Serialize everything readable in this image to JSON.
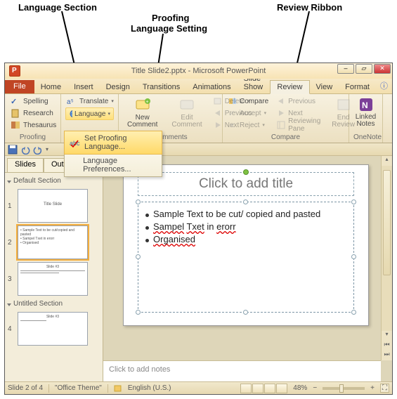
{
  "annotations": {
    "language_section": "Language Section",
    "review_ribbon": "Review Ribbon",
    "proofing_lang_line1": "Proofing",
    "proofing_lang_line2": "Language Setting"
  },
  "titlebar": {
    "title": "Title Slide2.pptx - Microsoft PowerPoint"
  },
  "tabs": {
    "file": "File",
    "home": "Home",
    "insert": "Insert",
    "design": "Design",
    "transitions": "Transitions",
    "animations": "Animations",
    "slideshow": "Slide Show",
    "review": "Review",
    "view": "View",
    "format": "Format"
  },
  "ribbon": {
    "proofing": {
      "label": "Proofing",
      "spelling": "Spelling",
      "research": "Research",
      "thesaurus": "Thesaurus"
    },
    "language": {
      "translate": "Translate",
      "language": "Language",
      "menu_set": "Set Proofing Language...",
      "menu_prefs": "Language Preferences..."
    },
    "comments": {
      "label": "Comments",
      "new": "New\nComment",
      "edit": "Edit\nComment",
      "delete": "Delete",
      "previous": "Previous",
      "next": "Next"
    },
    "compare": {
      "label": "Compare",
      "compare": "Compare",
      "accept": "Accept",
      "reject": "Reject",
      "previous": "Previous",
      "next": "Next",
      "reviewing_pane": "Reviewing Pane",
      "end": "End\nReview"
    },
    "onenote": {
      "label": "OneNote",
      "linked": "Linked\nNotes"
    }
  },
  "sidepanel": {
    "tab_slides": "Slides",
    "tab_outline": "Outline",
    "section_default": "Default Section",
    "section_untitled": "Untitled Section",
    "thumb1": "Title Slide",
    "thumb2_l1": "Sample Text to be cut/copied and pasted",
    "thumb2_l2": "Sampel Txet in erorr",
    "thumb2_l3": "Organised",
    "thumb3_title": "Slide #3",
    "thumb4_title": "Slide #3"
  },
  "slide": {
    "title_placeholder": "Click to add title",
    "bul1": "Sample Text to be cut/ copied and pasted",
    "bul2_a": "Sampel",
    "bul2_b": "Txet",
    "bul2_c": " in ",
    "bul2_d": "erorr",
    "bul3": "Organised"
  },
  "notes": {
    "placeholder": "Click to add notes"
  },
  "statusbar": {
    "slide": "Slide 2 of 4",
    "theme": "\"Office Theme\"",
    "lang": "English (U.S.)",
    "zoom": "48%"
  }
}
